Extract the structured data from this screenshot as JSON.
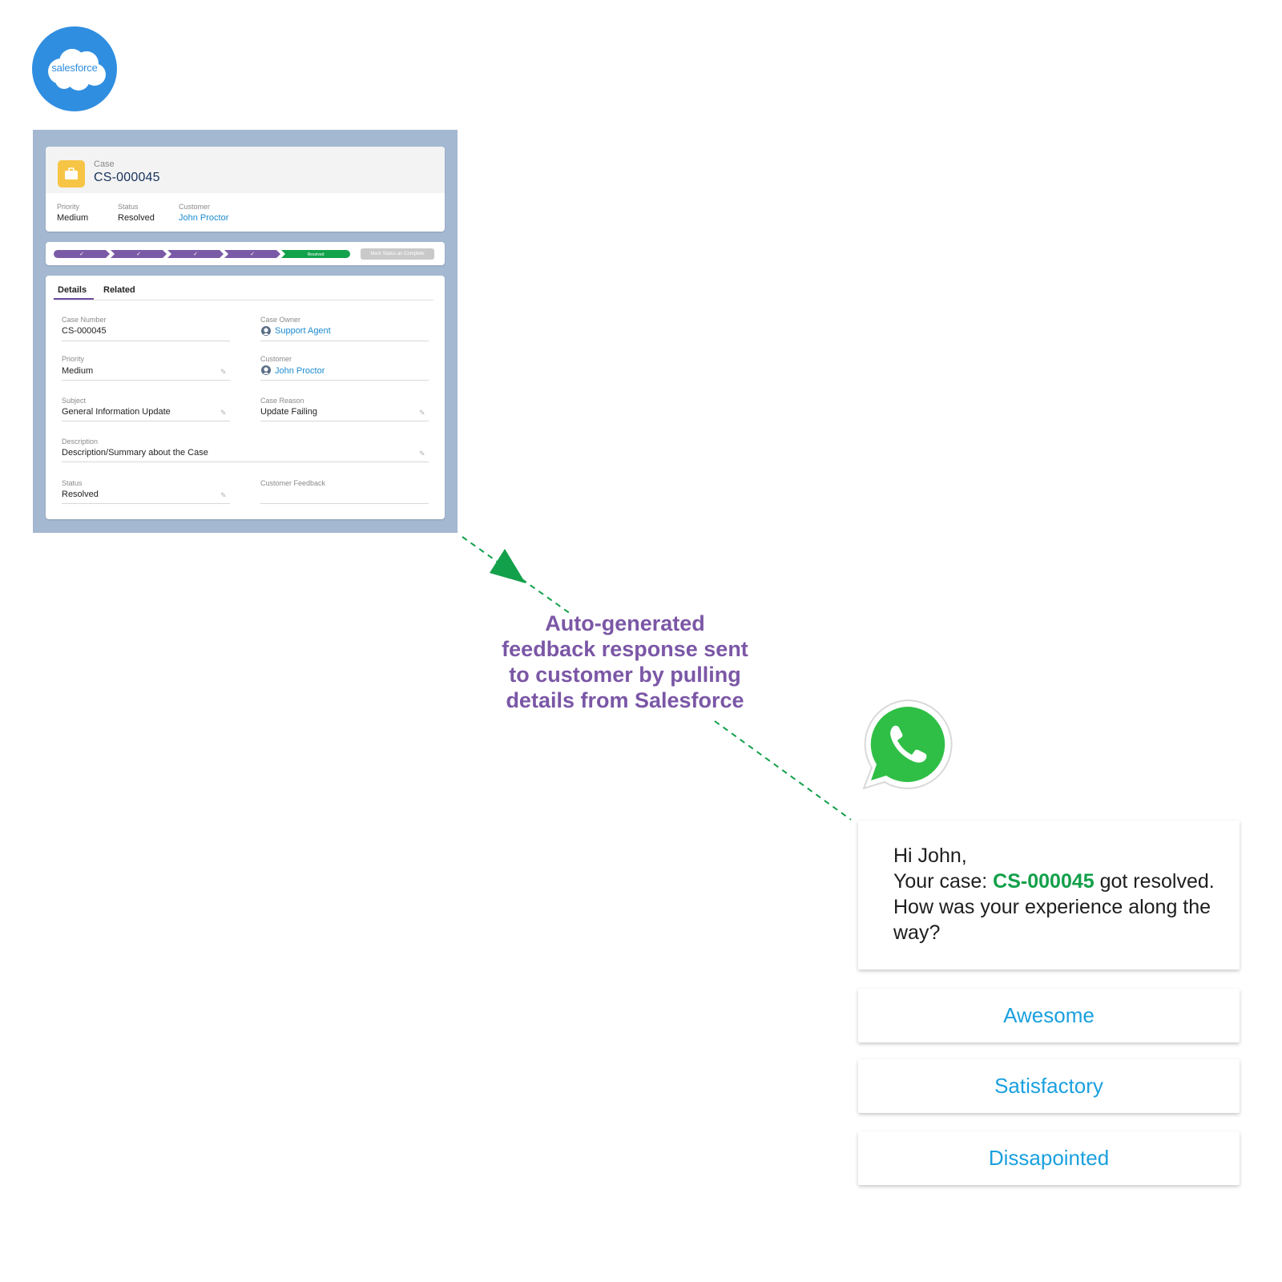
{
  "logo": {
    "brand_text": "salesforce",
    "icon": "salesforce-cloud-icon",
    "color": "#2f8ee0"
  },
  "case_record": {
    "object_label": "Case",
    "title": "CS-000045",
    "highlights": [
      {
        "label": "Priority",
        "value": "Medium"
      },
      {
        "label": "Status",
        "value": "Resolved"
      },
      {
        "label": "Customer",
        "value": "John Proctor"
      }
    ],
    "path": {
      "completed_steps": 4,
      "current_step_label": "Resolved",
      "action_label": "Mark Status as Complete",
      "colors": {
        "completed": "#7a5aa6",
        "current": "#12a24b"
      }
    },
    "tabs": [
      "Details",
      "Related"
    ],
    "fields": {
      "case_number": {
        "label": "Case Number",
        "value": "CS-000045"
      },
      "case_owner": {
        "label": "Case Owner",
        "value": "Support Agent"
      },
      "priority": {
        "label": "Priority",
        "value": "Medium"
      },
      "customer": {
        "label": "Customer",
        "value": "John Proctor"
      },
      "subject": {
        "label": "Subject",
        "value": "General Information Update"
      },
      "case_reason": {
        "label": "Case Reason",
        "value": "Update Failing"
      },
      "description": {
        "label": "Description",
        "value": "Description/Summary about the Case"
      },
      "status": {
        "label": "Status",
        "value": "Resolved"
      },
      "customer_feedback": {
        "label": "Customer Feedback",
        "value": ""
      }
    }
  },
  "annotation": {
    "lines": [
      "Auto-generated",
      "feedback response sent",
      "to customer by pulling",
      "details from Salesforce"
    ],
    "color": "#7b57a6"
  },
  "whatsapp": {
    "icon": "whatsapp-icon",
    "color": "#2fbf46"
  },
  "message": {
    "greeting": "Hi John,",
    "line_prefix": "Your case: ",
    "case_id": "CS-000045",
    "line_suffix": " got resolved. How was your experience along the way?",
    "case_id_color": "#13a04a"
  },
  "quick_replies": [
    "Awesome",
    "Satisfactory",
    "Dissapointed"
  ],
  "connector_color": "#13a04a"
}
